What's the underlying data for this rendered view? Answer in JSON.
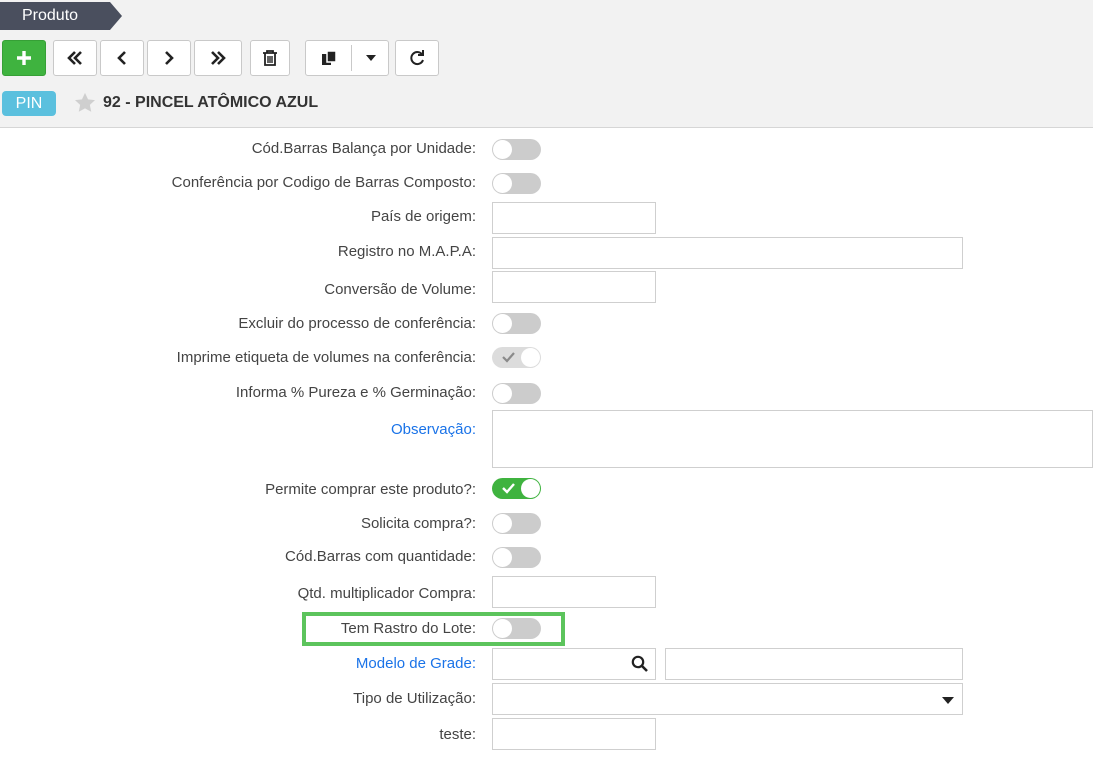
{
  "breadcrumb": {
    "label": "Produto"
  },
  "record": {
    "badge": "PIN",
    "title": "92 - PINCEL ATÔMICO AZUL"
  },
  "fields": {
    "cod_barras_balanca": "Cód.Barras Balança por Unidade:",
    "conferencia_cod_barras": "Conferência por Codigo de Barras Composto:",
    "pais_origem": "País de origem:",
    "registro_mapa": "Registro no M.A.P.A:",
    "conversao_volume": "Conversão de Volume:",
    "excluir_conferencia": "Excluir do processo de conferência:",
    "imprime_etiqueta": "Imprime etiqueta de volumes na conferência:",
    "informa_pureza": "Informa % Pureza e % Germinação:",
    "observacao": "Observação:",
    "permite_comprar": "Permite comprar este produto?:",
    "solicita_compra": "Solicita compra?:",
    "cod_barras_quantidade": "Cód.Barras com quantidade:",
    "qtd_multiplicador": "Qtd. multiplicador Compra:",
    "tem_rastro_lote": "Tem Rastro do Lote:",
    "modelo_grade": "Modelo de Grade:",
    "tipo_utilizacao": "Tipo de Utilização:",
    "teste": "teste:"
  },
  "toggles": {
    "cod_barras_balanca": "off",
    "conferencia_cod_barras": "off",
    "excluir_conferencia": "off",
    "imprime_etiqueta": "on-disabled",
    "informa_pureza": "off",
    "permite_comprar": "on",
    "solicita_compra": "off",
    "cod_barras_quantidade": "off",
    "tem_rastro_lote": "off"
  },
  "toolbar": [
    "add-icon",
    "first-icon",
    "prev-icon",
    "next-icon",
    "last-icon",
    "trash-icon",
    "copy-icon",
    "dropdown-caret-icon",
    "refresh-icon"
  ],
  "colors": {
    "accent_green": "#3fb33f",
    "badge_blue": "#5bc0de",
    "breadcrumb": "#4a4f5e",
    "link_blue": "#1a73e8",
    "highlight": "#5cc45c"
  }
}
